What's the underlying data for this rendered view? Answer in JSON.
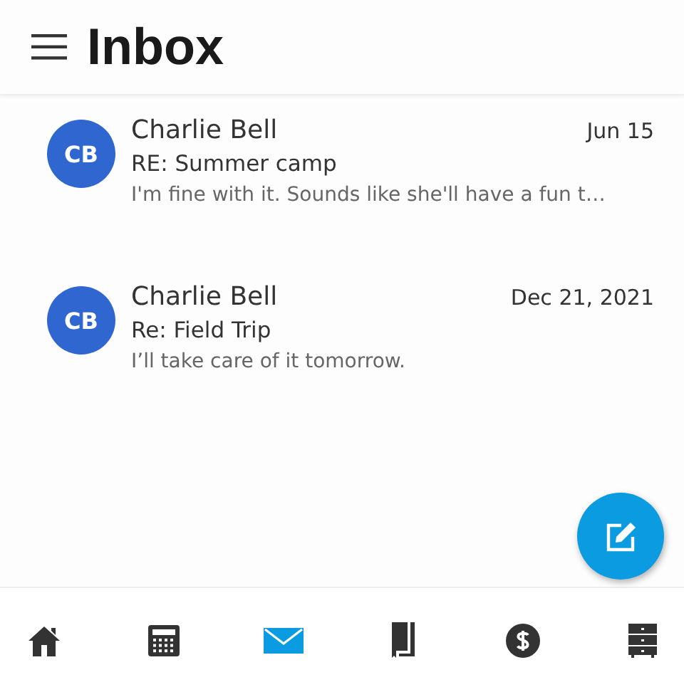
{
  "header": {
    "title": "Inbox"
  },
  "messages": [
    {
      "initials": "CB",
      "sender": "Charlie Bell",
      "date": "Jun 15",
      "subject": "RE: Summer camp",
      "preview": "I'm fine with it. Sounds like she'll have a fun t…"
    },
    {
      "initials": "CB",
      "sender": "Charlie Bell",
      "date": "Dec 21, 2021",
      "subject": "Re: Field Trip",
      "preview": "I’ll take care of it tomorrow."
    }
  ],
  "nav": [
    {
      "kind": "home",
      "selected": false
    },
    {
      "kind": "calculator",
      "selected": false
    },
    {
      "kind": "mail",
      "selected": true
    },
    {
      "kind": "book",
      "selected": false
    },
    {
      "kind": "dollar",
      "selected": false
    },
    {
      "kind": "drawers",
      "selected": false
    }
  ]
}
